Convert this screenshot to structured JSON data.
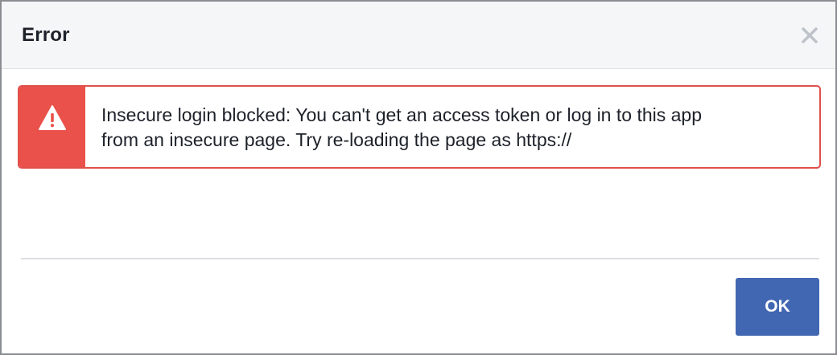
{
  "dialog": {
    "title": "Error",
    "close_icon": "close-icon"
  },
  "alert": {
    "icon": "warning-triangle-icon",
    "line1": "Insecure login blocked: You can't get an access token or log in to this app",
    "line2": "from an insecure page. Try re-loading the page as https://",
    "accent_color": "#e9514a"
  },
  "footer": {
    "ok_label": "OK",
    "button_color": "#4267b2"
  }
}
